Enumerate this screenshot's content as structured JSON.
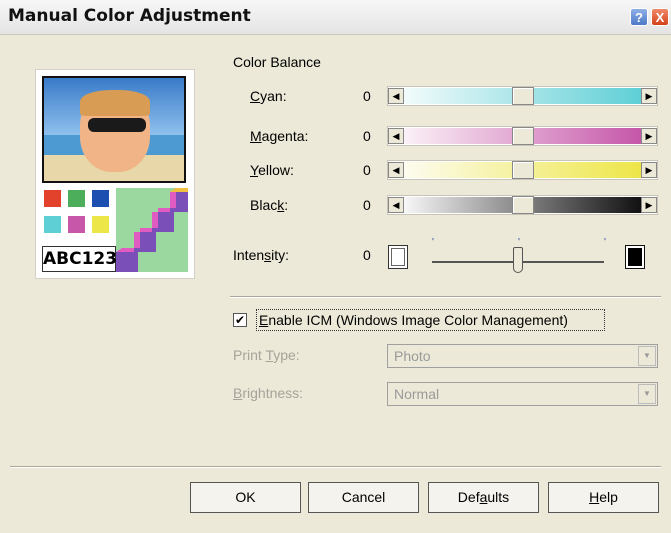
{
  "window": {
    "title": "Manual Color Adjustment",
    "help_glyph": "?",
    "close_glyph": "X"
  },
  "preview": {
    "caption": "ABC123"
  },
  "color_balance": {
    "heading": "Color Balance",
    "sliders": [
      {
        "pre": "",
        "u": "C",
        "post": "yan:",
        "value": "0",
        "color_left": "#f2fbfb",
        "color_right": "#5fcfd6"
      },
      {
        "pre": "",
        "u": "M",
        "post": "agenta:",
        "value": "0",
        "color_left": "#fbf1f7",
        "color_right": "#c657a9"
      },
      {
        "pre": "",
        "u": "Y",
        "post": "ellow:",
        "value": "0",
        "color_left": "#fdfcef",
        "color_right": "#ede648"
      },
      {
        "pre": "Blac",
        "u": "k",
        "post": ":",
        "value": "0",
        "color_left": "#f7f7f7",
        "color_right": "#111111"
      }
    ],
    "thumb_position": 0.5
  },
  "intensity": {
    "pre": "Inten",
    "u": "s",
    "post": "ity:",
    "value": "0",
    "tick_mark": "'",
    "thumb_position": 0.5
  },
  "icm": {
    "checked": true,
    "check_glyph": "✔",
    "pre": "",
    "u": "E",
    "post": "nable ICM (Windows Image Color Management)"
  },
  "print_type": {
    "pre": "Print ",
    "u": "T",
    "post": "ype:",
    "value": "Photo"
  },
  "brightness": {
    "pre": "",
    "u": "B",
    "post": "rightness:",
    "value": "Normal"
  },
  "arrows": {
    "left": "◀",
    "right": "▶",
    "down": "▼"
  },
  "buttons": {
    "ok": {
      "label": "OK"
    },
    "cancel": {
      "label": "Cancel"
    },
    "defaults": {
      "pre": "Def",
      "u": "a",
      "post": "ults"
    },
    "help": {
      "pre": "",
      "u": "H",
      "post": "elp"
    }
  },
  "colors": {
    "accent": "#316ac5",
    "window_bg": "#ece9d8",
    "disabled_text": "#a5a39a"
  }
}
